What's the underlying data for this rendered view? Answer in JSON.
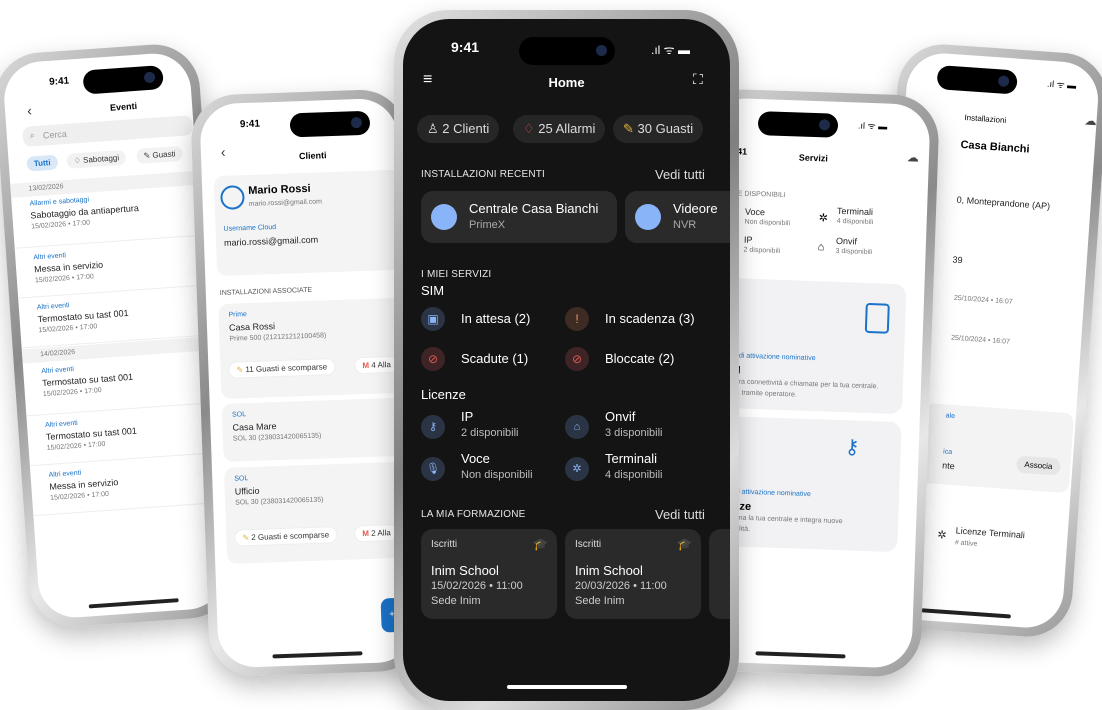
{
  "phone_left_far": {
    "time": "9:41",
    "title": "Eventi",
    "search_placeholder": "Cerca",
    "filters": [
      "Tutti",
      "Sabotaggi",
      "Guasti"
    ],
    "events": [
      {
        "date_header": "13/02/2026"
      },
      {
        "category": "Allarmi e sabotaggi",
        "title": "Sabotaggio da antiapertura",
        "time": "15/02/2026 • 17:00"
      },
      {
        "category": "Altri eventi",
        "title": "Messa in servizio",
        "time": "15/02/2026 • 17:00"
      },
      {
        "category": "Altri eventi",
        "title": "Termostato su tast 001",
        "time": "15/02/2026 • 17:00"
      },
      {
        "date_header": "14/02/2026"
      },
      {
        "category": "Altri eventi",
        "title": "Termostato su tast 001",
        "time": "15/02/2026 • 17:00"
      },
      {
        "category": "Altri eventi",
        "title": "Termostato su tast 001",
        "time": "15/02/2026 • 17:00"
      },
      {
        "category": "Altri eventi",
        "title": "Messa in servizio",
        "time": "15/02/2026 • 17:00"
      }
    ]
  },
  "phone_left": {
    "time": "9:41",
    "title": "Clienti",
    "client_name": "Mario Rossi",
    "client_email": "mario.rossi@gmail.com",
    "username_label": "Username Cloud",
    "username_value": "mario.rossi@gmail.com",
    "installations_header": "INSTALLAZIONI ASSOCIATE",
    "installations": [
      {
        "type": "Prime",
        "name": "Casa Rossi",
        "model": "Prime 500 (212121212100458)",
        "badge1": "11 Guasti e scomparse",
        "badge2": "4 Alla"
      },
      {
        "type": "SOL",
        "name": "Casa Mare",
        "model": "SOL 30 (238031420065135)"
      },
      {
        "type": "SOL",
        "name": "Ufficio",
        "model": "SOL 30 (238031420065135)",
        "badge1": "2 Guasti e scomparse",
        "badge2": "2 Alla"
      }
    ],
    "fab_label": "+ A"
  },
  "phone_center": {
    "time": "9:41",
    "title": "Home",
    "chips": [
      "2 Clienti",
      "25 Allarmi",
      "30 Guasti"
    ],
    "recent_header": "INSTALLAZIONI RECENTI",
    "see_all": "Vedi tutti",
    "recent": [
      {
        "name": "Centrale Casa Bianchi",
        "sub": "PrimeX"
      },
      {
        "name": "Videore",
        "sub": "NVR"
      }
    ],
    "services_header": "I MIEI SERVIZI",
    "sim_label": "SIM",
    "sim_items": [
      "In attesa (2)",
      "In scadenza (3)",
      "Scadute (1)",
      "Bloccate (2)"
    ],
    "licenses_label": "Licenze",
    "licenses": [
      {
        "name": "IP",
        "sub": "2 disponibili"
      },
      {
        "name": "Onvif",
        "sub": "3 disponibili"
      },
      {
        "name": "Voce",
        "sub": "Non disponibili"
      },
      {
        "name": "Terminali",
        "sub": "4 disponibili"
      }
    ],
    "training_header": "LA MIA FORMAZIONE",
    "training_see_all": "Vedi tutti",
    "trainings": [
      {
        "tag": "Iscritti",
        "name": "Inim School",
        "date": "15/02/2026 • 11:00",
        "place": "Sede Inim"
      },
      {
        "tag": "Iscritti",
        "name": "Inim School",
        "date": "20/03/2026 • 11:00",
        "place": "Sede Inim"
      }
    ]
  },
  "phone_right": {
    "time": "9:41",
    "title": "Servizi",
    "available_header": "ZE DISPONIBILI",
    "avail": [
      {
        "name": "Voce",
        "sub": "Non disponibili"
      },
      {
        "name": "Terminali",
        "sub": "4 disponibili"
      },
      {
        "name": "IP",
        "sub": "2 disponibili"
      },
      {
        "name": "Onvif",
        "sub": "3 disponibili"
      }
    ],
    "sim_card_tag": "vi di attivazione nominative",
    "sim_card_title": "M",
    "sim_card_desc": "egra connettività e chiamate per la tua centrale.",
    "sim_card_desc2": "iva tramite operatore.",
    "lic_card_tag": "vi di attivazione nominative",
    "lic_card_title": "enze",
    "lic_card_desc": "sciona la tua centrale e integra nuove",
    "lic_card_desc2": "ionalità."
  },
  "phone_right_far": {
    "time": "9:41",
    "header": "Installazioni",
    "name": "Casa Bianchi",
    "address": "0, Monteprandone (AP)",
    "code": "39",
    "date1": "25/10/2024 • 16:07",
    "date2": "25/10/2024 • 16:07",
    "label1": "ale",
    "label2": "ica",
    "label2_value": "nte",
    "associa": "Associa",
    "lic_title": "Licenze Terminali",
    "lic_sub": "# attive"
  },
  "colors": {
    "accent": "#1a73c9",
    "dark_bg": "#141414",
    "card_dark": "#2a2a2a",
    "alarm_red": "#e05a4e",
    "warn_yellow": "#e0b341"
  }
}
